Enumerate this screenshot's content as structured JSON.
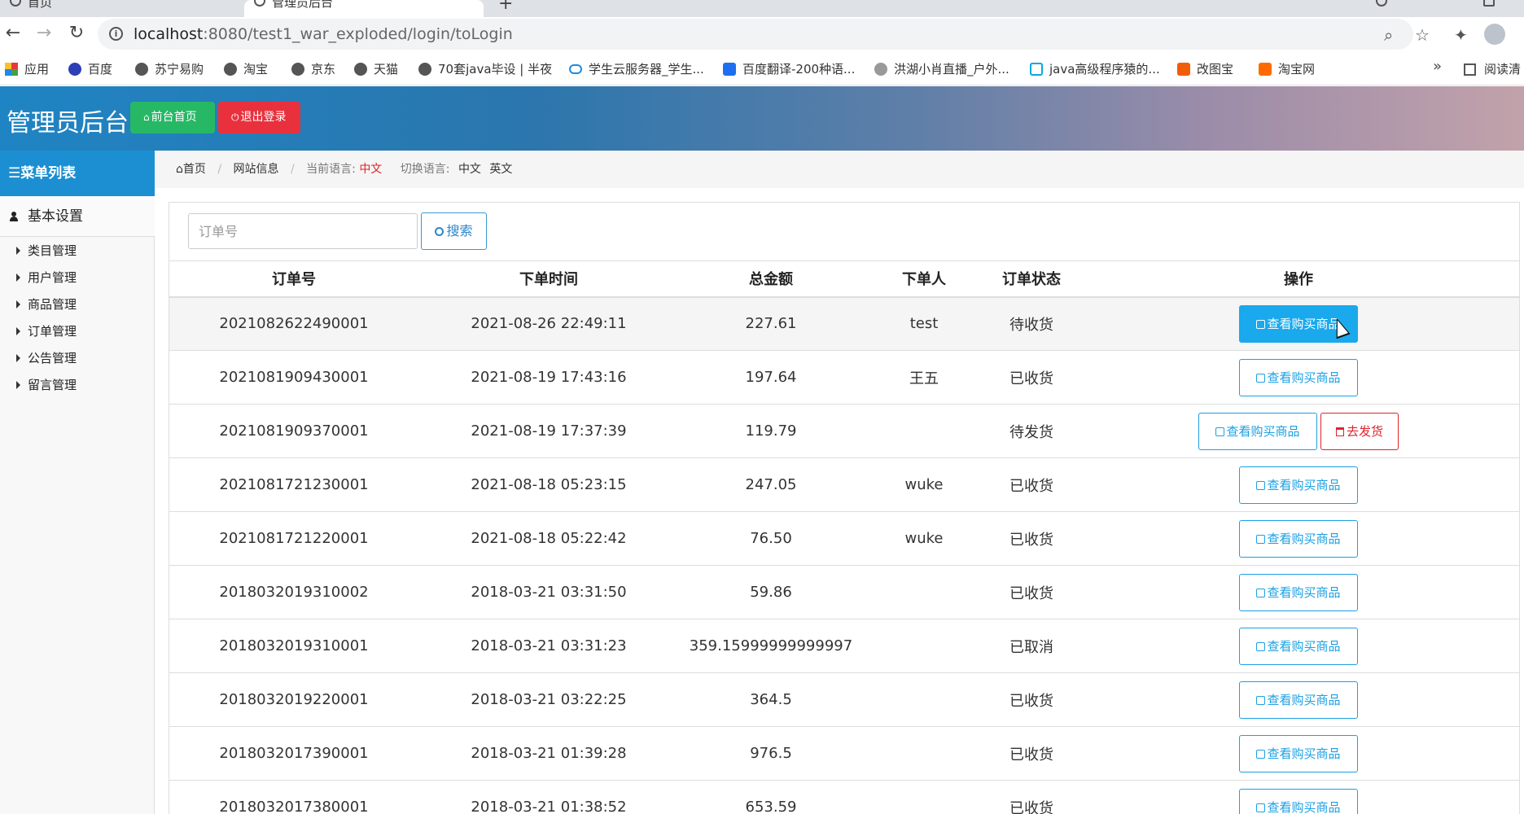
{
  "browser": {
    "tabs": [
      {
        "label": "首页"
      },
      {
        "label": "管理员后台"
      }
    ],
    "new_tab": "+",
    "url_host": "localhost",
    "url_path": ":8080/test1_war_exploded/login/toLogin",
    "bookmarks": [
      {
        "label": "应用",
        "icon": "apps-grid-icon"
      },
      {
        "label": "百度",
        "icon": "baidu-paw-icon"
      },
      {
        "label": "苏宁易购",
        "icon": "globe-icon"
      },
      {
        "label": "淘宝",
        "icon": "globe-icon"
      },
      {
        "label": "京东",
        "icon": "globe-icon"
      },
      {
        "label": "天猫",
        "icon": "globe-icon"
      },
      {
        "label": "70套java毕设 | 半夜",
        "icon": "globe-icon"
      },
      {
        "label": "学生云服务器_学生...",
        "icon": "cloud-icon"
      },
      {
        "label": "百度翻译-200种语...",
        "icon": "translate-icon"
      },
      {
        "label": "洪湖小肖直播_户外...",
        "icon": "site-icon"
      },
      {
        "label": "java高级程序猿的...",
        "icon": "bilibili-icon"
      },
      {
        "label": "改图宝",
        "icon": "site-icon"
      },
      {
        "label": "淘宝网",
        "icon": "taobao-icon"
      }
    ],
    "more": "»",
    "reading_list": "阅读清"
  },
  "header": {
    "title": "管理员后台",
    "home_button": "前台首页",
    "logout_button": "退出登录",
    "colors": {
      "home": "#26b865",
      "logout": "#e8313d"
    }
  },
  "sidebar": {
    "menu_title": "菜单列表",
    "group": "基本设置",
    "items": [
      {
        "label": "类目管理"
      },
      {
        "label": "用户管理"
      },
      {
        "label": "商品管理"
      },
      {
        "label": "订单管理"
      },
      {
        "label": "公告管理"
      },
      {
        "label": "留言管理"
      }
    ]
  },
  "breadcrumb": {
    "home": "首页",
    "site_info": "网站信息",
    "current_lang_label": "当前语言:",
    "current_lang": "中文",
    "switch_lang_label": "切换语言:",
    "lang_options": [
      "中文",
      "英文"
    ]
  },
  "search": {
    "placeholder": "订单号",
    "button": "搜索"
  },
  "table": {
    "columns": [
      "订单号",
      "下单时间",
      "总金额",
      "下单人",
      "订单状态",
      "操作"
    ],
    "view_button": "查看购买商品",
    "ship_button": "去发货",
    "rows": [
      {
        "id": "2021082622490001",
        "time": "2021-08-26 22:49:11",
        "amount": "227.61",
        "user": "test",
        "status": "待收货"
      },
      {
        "id": "2021081909430001",
        "time": "2021-08-19 17:43:16",
        "amount": "197.64",
        "user": "王五",
        "status": "已收货"
      },
      {
        "id": "2021081909370001",
        "time": "2021-08-19 17:37:39",
        "amount": "119.79",
        "user": "",
        "status": "待发货"
      },
      {
        "id": "2021081721230001",
        "time": "2021-08-18 05:23:15",
        "amount": "247.05",
        "user": "wuke",
        "status": "已收货"
      },
      {
        "id": "2021081721220001",
        "time": "2021-08-18 05:22:42",
        "amount": "76.50",
        "user": "wuke",
        "status": "已收货"
      },
      {
        "id": "2018032019310002",
        "time": "2018-03-21 03:31:50",
        "amount": "59.86",
        "user": "",
        "status": "已收货"
      },
      {
        "id": "2018032019310001",
        "time": "2018-03-21 03:31:23",
        "amount": "359.15999999999997",
        "user": "",
        "status": "已取消"
      },
      {
        "id": "2018032019220001",
        "time": "2018-03-21 03:22:25",
        "amount": "364.5",
        "user": "",
        "status": "已收货"
      },
      {
        "id": "2018032017390001",
        "time": "2018-03-21 01:39:28",
        "amount": "976.5",
        "user": "",
        "status": "已收货"
      },
      {
        "id": "2018032017380001",
        "time": "2018-03-21 01:38:52",
        "amount": "653.59",
        "user": "",
        "status": "已收货"
      }
    ]
  }
}
